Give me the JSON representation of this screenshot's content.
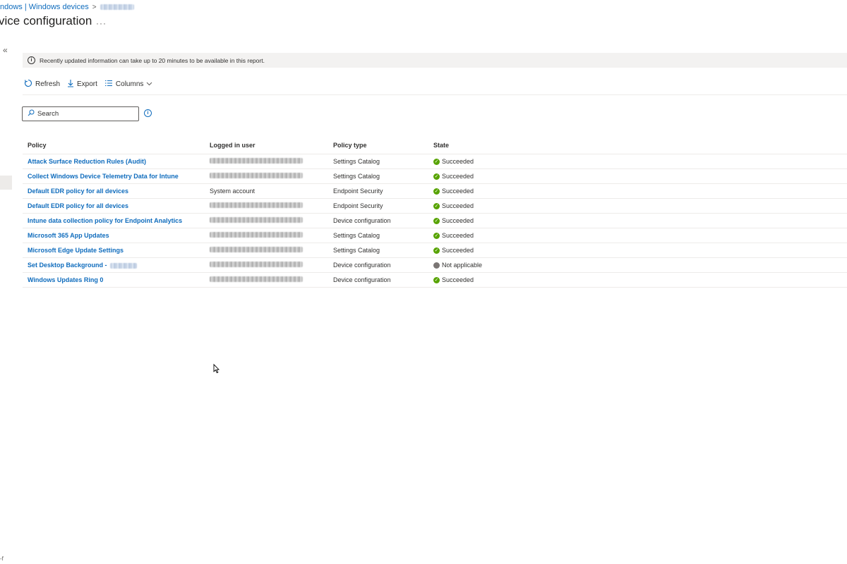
{
  "breadcrumb": {
    "items": [
      "ndows | Windows devices"
    ],
    "device_redacted": true
  },
  "page": {
    "title": "vice configuration",
    "more": "···"
  },
  "info_banner": {
    "text": "Recently updated information can take up to 20 minutes to be available in this report."
  },
  "toolbar": {
    "refresh": "Refresh",
    "export": "Export",
    "columns": "Columns"
  },
  "search": {
    "placeholder": "Search"
  },
  "table": {
    "headers": [
      "Policy",
      "Logged in user",
      "Policy type",
      "State"
    ],
    "rows": [
      {
        "policy": "Attack Surface Reduction Rules (Audit)",
        "user": "",
        "type": "Settings Catalog",
        "state": "Succeeded",
        "status": "ok"
      },
      {
        "policy": "Collect Windows Device Telemetry Data for Intune",
        "user": "",
        "type": "Settings Catalog",
        "state": "Succeeded",
        "status": "ok"
      },
      {
        "policy": "Default EDR policy for all devices",
        "user": "System account",
        "type": "Endpoint Security",
        "state": "Succeeded",
        "status": "ok"
      },
      {
        "policy": "Default EDR policy for all devices",
        "user": "",
        "type": "Endpoint Security",
        "state": "Succeeded",
        "status": "ok"
      },
      {
        "policy": "Intune data collection policy for Endpoint Analytics",
        "user": "",
        "type": "Device configuration",
        "state": "Succeeded",
        "status": "ok"
      },
      {
        "policy": "Microsoft 365 App Updates",
        "user": "",
        "type": "Settings Catalog",
        "state": "Succeeded",
        "status": "ok"
      },
      {
        "policy": "Microsoft Edge Update Settings",
        "user": "",
        "type": "Settings Catalog",
        "state": "Succeeded",
        "status": "ok"
      },
      {
        "policy": "Set Desktop Background -",
        "user": "",
        "type": "Device configuration",
        "state": "Not applicable",
        "status": "na"
      },
      {
        "policy": "Windows Updates Ring 0",
        "user": "",
        "type": "Device configuration",
        "state": "Succeeded",
        "status": "ok"
      }
    ]
  },
  "colors": {
    "link": "#0f6cbd",
    "success": "#57a300",
    "neutral": "#7a7574",
    "banner": "#f3f2f1"
  },
  "icons": [
    "chevron-right-icon",
    "more-icon",
    "collapse-icon",
    "info-icon",
    "refresh-icon",
    "download-icon",
    "columns-icon",
    "chevron-down-icon",
    "search-icon",
    "checkmark-circle-icon",
    "circle-icon",
    "mouse-cursor-icon"
  ]
}
